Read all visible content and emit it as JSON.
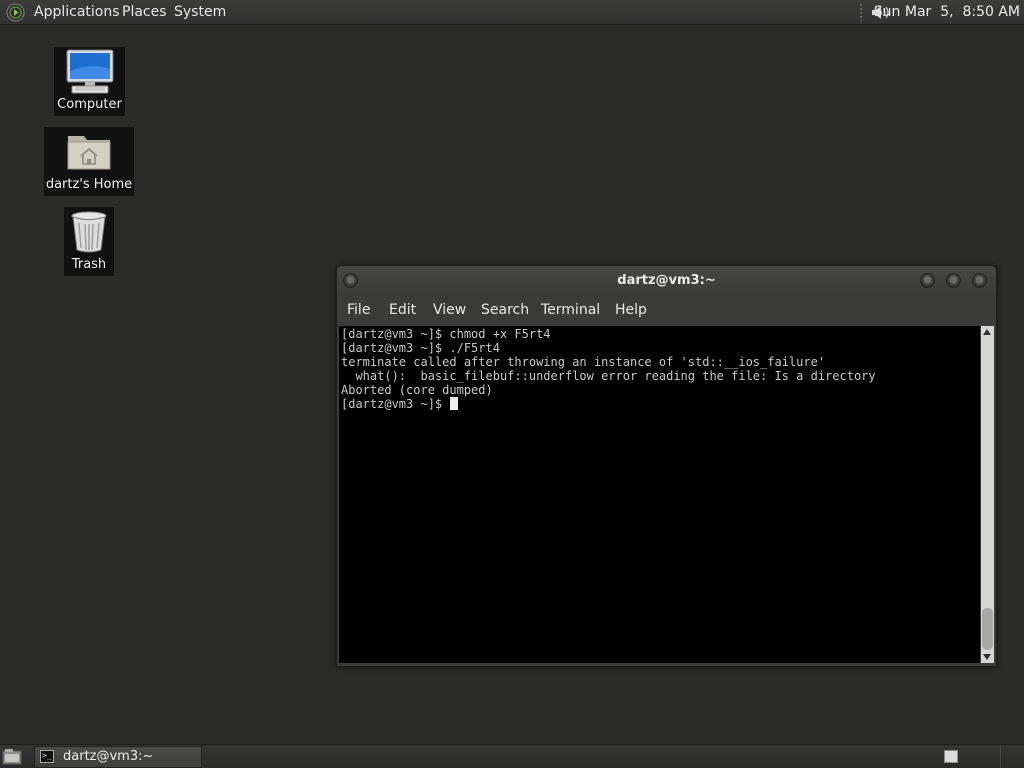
{
  "top_panel": {
    "menus": [
      "Applications",
      "Places",
      "System"
    ],
    "clock": "Sun Mar  5,  8:50 AM",
    "icons": [
      "gnome-foot-icon",
      "volume-icon"
    ]
  },
  "desktop": {
    "icons": [
      {
        "label": "Computer",
        "icon": "computer-icon"
      },
      {
        "label": "dartz's Home",
        "icon": "home-folder-icon"
      },
      {
        "label": "Trash",
        "icon": "trash-icon"
      }
    ]
  },
  "terminal": {
    "title": "dartz@vm3:~",
    "menu": [
      "File",
      "Edit",
      "View",
      "Search",
      "Terminal",
      "Help"
    ],
    "lines": [
      "[dartz@vm3 ~]$ chmod +x F5rt4",
      "[dartz@vm3 ~]$ ./F5rt4",
      "terminate called after throwing an instance of 'std::__ios_failure'",
      "  what():  basic_filebuf::underflow error reading the file: Is a directory",
      "Aborted (core dumped)",
      "[dartz@vm3 ~]$ "
    ]
  },
  "taskbar": {
    "tasks": [
      {
        "label": "dartz@vm3:~",
        "icon": "terminal-icon"
      }
    ],
    "icons": [
      "show-desktop-icon",
      "workspace-switcher-icon"
    ]
  }
}
